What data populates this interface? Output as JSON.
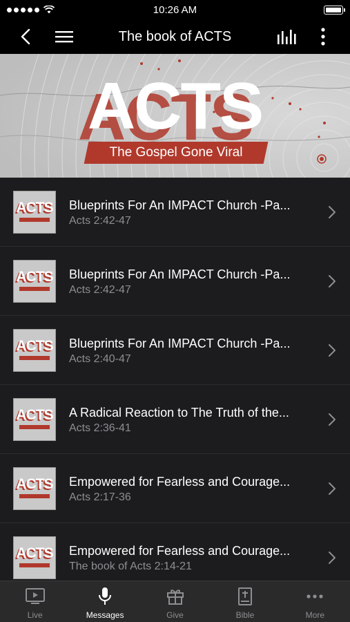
{
  "status_bar": {
    "time": "10:26 AM"
  },
  "nav": {
    "title": "The book of ACTS"
  },
  "banner": {
    "title": "ACTS",
    "subtitle": "The Gospel Gone Viral"
  },
  "thumb": {
    "title": "ACTS"
  },
  "items": [
    {
      "title": "Blueprints For An IMPACT Church -Pa...",
      "subtitle": "Acts 2:42-47"
    },
    {
      "title": "Blueprints For An IMPACT Church -Pa...",
      "subtitle": "Acts 2:42-47"
    },
    {
      "title": "Blueprints For An IMPACT Church -Pa...",
      "subtitle": "Acts 2:40-47"
    },
    {
      "title": "A Radical Reaction to The Truth of the...",
      "subtitle": "Acts 2:36-41"
    },
    {
      "title": "Empowered for Fearless and Courage...",
      "subtitle": "Acts 2:17-36"
    },
    {
      "title": "Empowered for Fearless and Courage...",
      "subtitle": "The book of Acts 2:14-21"
    }
  ],
  "tabs": [
    {
      "label": "Live",
      "icon": "live-video-icon"
    },
    {
      "label": "Messages",
      "icon": "microphone-icon"
    },
    {
      "label": "Give",
      "icon": "gift-icon"
    },
    {
      "label": "Bible",
      "icon": "bible-icon"
    },
    {
      "label": "More",
      "icon": "more-dots-icon"
    }
  ],
  "colors": {
    "accent": "#b0392c",
    "list_bg": "#1c1c1e",
    "tab_bg": "#2a2a2a",
    "inactive": "#8e8e93"
  }
}
